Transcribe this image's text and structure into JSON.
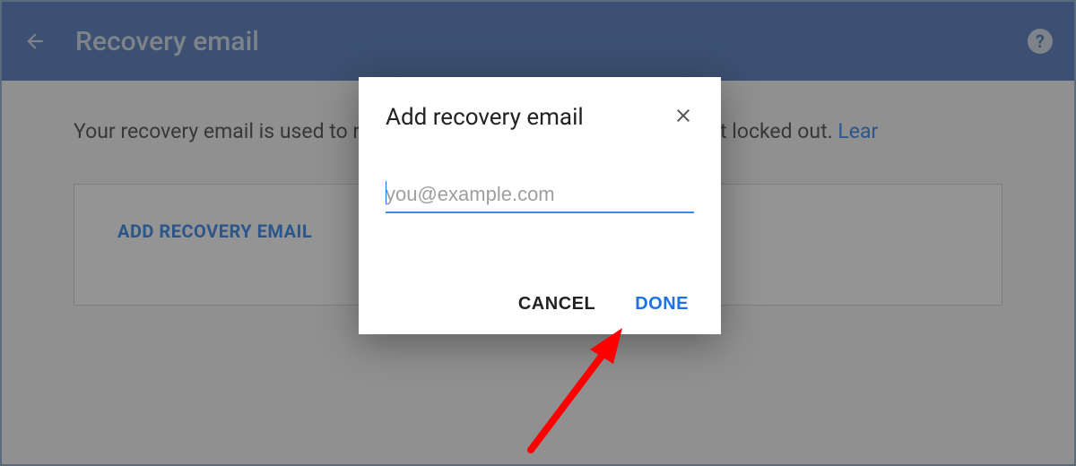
{
  "header": {
    "title": "Recovery email"
  },
  "page": {
    "description_part1": "Your recovery email is used to re",
    "description_part2": " in your account or you accidentally get locked out. ",
    "learn_more": "Lear",
    "add_button": "ADD RECOVERY EMAIL"
  },
  "dialog": {
    "title": "Add recovery email",
    "email_placeholder": "you@example.com",
    "email_value": "",
    "cancel": "CANCEL",
    "done": "DONE"
  }
}
